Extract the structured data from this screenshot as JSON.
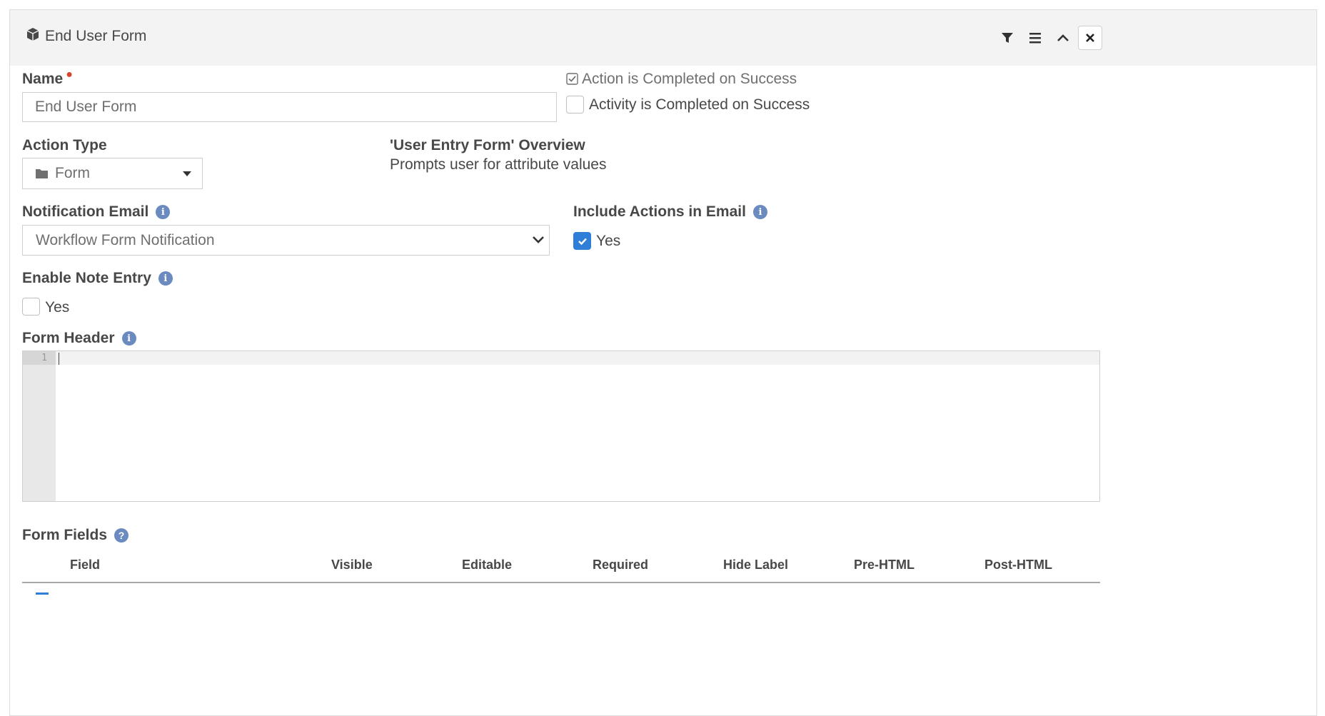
{
  "panel": {
    "title": "End User Form",
    "icons": [
      "cube-icon",
      "filter-icon",
      "menu-icon",
      "chevron-up-icon",
      "close-icon"
    ]
  },
  "name_field": {
    "label": "Name",
    "required": true,
    "value": "End User Form"
  },
  "action_completed": {
    "label": "Action is Completed on Success",
    "checked": true
  },
  "activity_completed": {
    "label": "Activity is Completed on Success",
    "checked": false
  },
  "action_type": {
    "label": "Action Type",
    "value": "Form",
    "icon": "folder-icon"
  },
  "overview": {
    "title": "'User Entry Form' Overview",
    "description": "Prompts user for attribute values"
  },
  "notification_email": {
    "label": "Notification Email",
    "value": "Workflow Form Notification"
  },
  "include_actions": {
    "label": "Include Actions in Email",
    "option_label": "Yes",
    "checked": true
  },
  "enable_note": {
    "label": "Enable Note Entry",
    "option_label": "Yes",
    "checked": false
  },
  "form_header": {
    "label": "Form Header",
    "line_number": "1",
    "content": ""
  },
  "form_fields": {
    "label": "Form Fields",
    "columns": [
      "Field",
      "Visible",
      "Editable",
      "Required",
      "Hide Label",
      "Pre-HTML",
      "Post-HTML"
    ]
  },
  "colors": {
    "accent": "#2f7ed8",
    "info_icon": "#6b8bc0",
    "required": "#d4442e",
    "header_bg": "#f3f3f3"
  }
}
